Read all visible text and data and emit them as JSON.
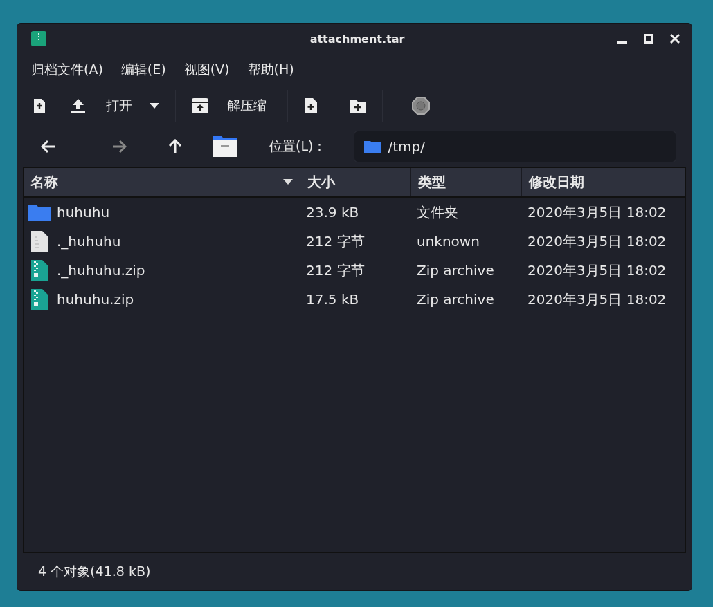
{
  "window": {
    "title": "attachment.tar"
  },
  "menu": [
    "归档文件(A)",
    "编辑(E)",
    "视图(V)",
    "帮助(H)"
  ],
  "toolbar": {
    "open_label": "打开",
    "extract_label": "解压缩"
  },
  "location": {
    "label": "位置(L)：",
    "path": "/tmp/"
  },
  "table": {
    "columns": [
      "名称",
      "大小",
      "类型",
      "修改日期"
    ],
    "rows": [
      {
        "kind": "folder",
        "name": "huhuhu",
        "size": "23.9 kB",
        "type": "文件夹",
        "modified": "2020年3月5日 18:02"
      },
      {
        "kind": "text",
        "name": "._huhuhu",
        "size": "212 字节",
        "type": "unknown",
        "modified": "2020年3月5日 18:02"
      },
      {
        "kind": "zip",
        "name": "._huhuhu.zip",
        "size": "212 字节",
        "type": "Zip archive",
        "modified": "2020年3月5日 18:02"
      },
      {
        "kind": "zip",
        "name": "huhuhu.zip",
        "size": "17.5 kB",
        "type": "Zip archive",
        "modified": "2020年3月5日 18:02"
      }
    ]
  },
  "status_bar": "4 个对象(41.8 kB)"
}
